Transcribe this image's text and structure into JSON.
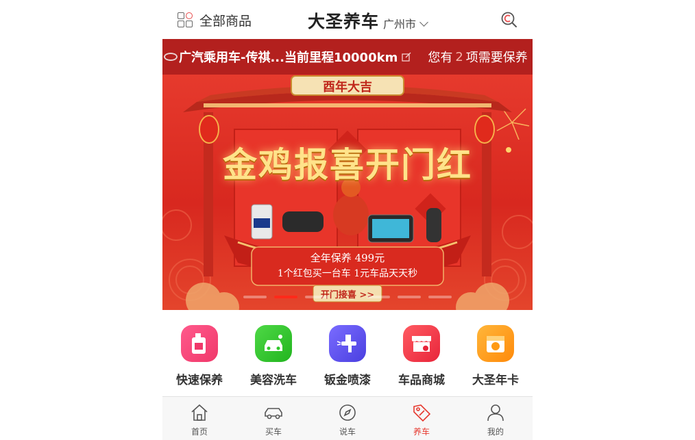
{
  "header": {
    "all_goods_label": "全部商品",
    "title": "大圣养车",
    "city": "广州市"
  },
  "car_bar": {
    "car_info": "广汽乘用车-传祺...当前里程10000km",
    "maintenance_prefix": "您有",
    "maintenance_count": "2",
    "maintenance_suffix": "项需要保养"
  },
  "banner": {
    "top_badge": "酉年大吉",
    "headline": "金鸡报喜开门红",
    "line1": "全年保养 499元",
    "line2": "1个红包买一台车  1元车品天天秒",
    "cta": "开门接喜 >>",
    "slide_count": 6,
    "active_slide": 1
  },
  "shortcuts": [
    {
      "label": "快速保养",
      "icon": "oil-bottle-icon",
      "color": "#f0386a"
    },
    {
      "label": "美容洗车",
      "icon": "car-wash-icon",
      "color": "#2fc82a"
    },
    {
      "label": "钣金喷漆",
      "icon": "spray-gun-icon",
      "color": "#5a4ff0"
    },
    {
      "label": "车品商城",
      "icon": "store-icon",
      "color": "#f2394b"
    },
    {
      "label": "大圣年卡",
      "icon": "annual-card-icon",
      "color": "#ff9a12"
    }
  ],
  "tabbar": [
    {
      "label": "首页",
      "icon": "home-icon",
      "active": false
    },
    {
      "label": "买车",
      "icon": "car-icon",
      "active": false
    },
    {
      "label": "说车",
      "icon": "compass-icon",
      "active": false
    },
    {
      "label": "养车",
      "icon": "tag-icon",
      "active": true
    },
    {
      "label": "我的",
      "icon": "user-icon",
      "active": false
    }
  ],
  "colors": {
    "brand_red": "#b3201e",
    "tab_active": "#e6382e"
  }
}
